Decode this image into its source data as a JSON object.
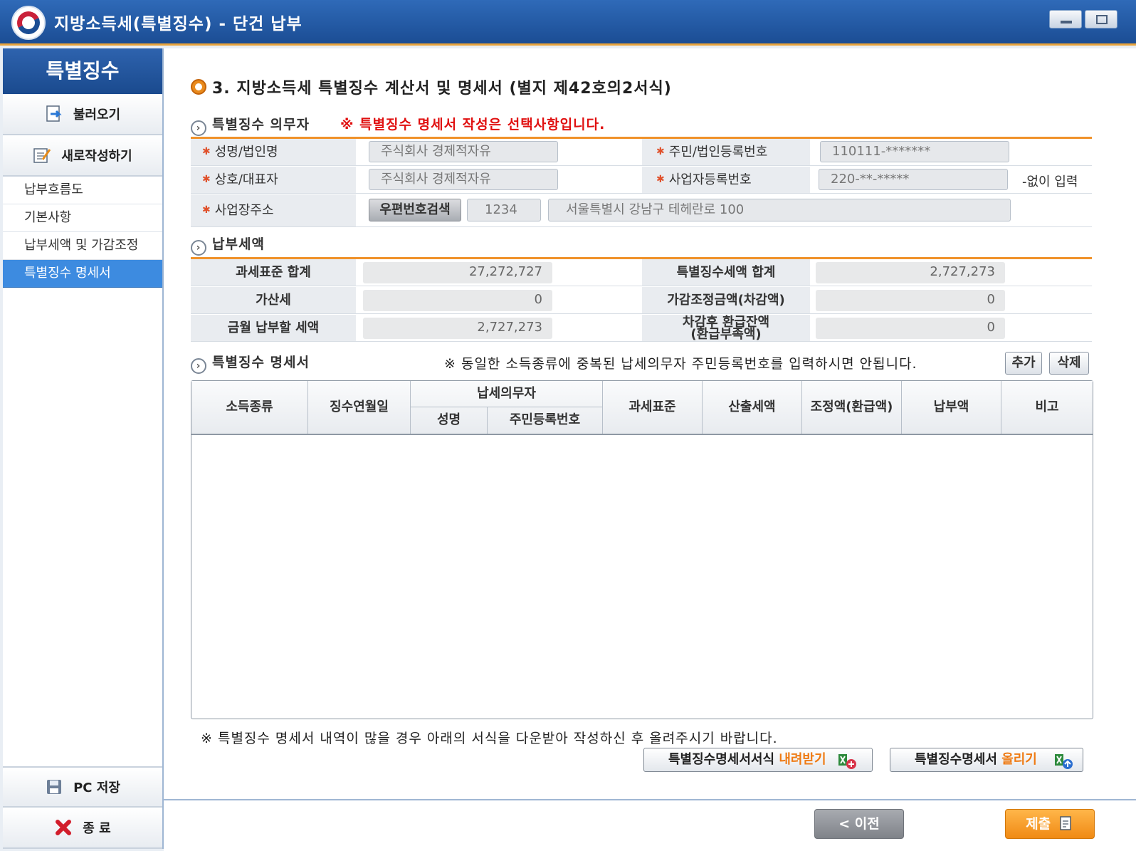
{
  "window": {
    "title": "지방소득세(특별징수) - 단건 납부"
  },
  "sidebar": {
    "header": "특별징수",
    "load_button": "불러오기",
    "new_button": "새로작성하기",
    "nav": [
      "납부흐름도",
      "기본사항",
      "납부세액 및 가감조정",
      "특별징수 명세서"
    ],
    "active_index": 3,
    "pc_save": "PC 저장",
    "exit": "종 료"
  },
  "main": {
    "section_title": "3. 지방소득세 특별징수 계산서 및 명세서 (별지 제42호의2서식)",
    "obligor": {
      "title": "특별징수 의무자",
      "notice": "※ 특별징수 명세서 작성은 선택사항입니다.",
      "name_label": "성명/법인명",
      "name_value": "주식회사 경제적자유",
      "resident_label": "주민/법인등록번호",
      "resident_value": "110111-*******",
      "company_label": "상호/대표자",
      "company_value": "주식회사 경제적자유",
      "bizno_label": "사업자등록번호",
      "bizno_value": "220-**-*****",
      "bizno_hint": "-없이 입력",
      "address_label": "사업장주소",
      "zip_button": "우편번호검색",
      "zip_value": "1234",
      "address_value": "서울특별시 강남구 테헤란로 100"
    },
    "tax": {
      "title": "납부세액",
      "std_total_label": "과세표준 합계",
      "std_total_value": "27,272,727",
      "special_total_label": "특별징수세액 합계",
      "special_total_value": "2,727,273",
      "penalty_label": "가산세",
      "penalty_value": "0",
      "adjust_label": "가감조정금액(차감액)",
      "adjust_value": "0",
      "month_label": "금월 납부할 세액",
      "month_value": "2,727,273",
      "refund_label_1": "차감후 환급잔액",
      "refund_label_2": "(환급부족액)",
      "refund_value": "0"
    },
    "statement": {
      "title": "특별징수 명세서",
      "notice": "※ 동일한 소득종류에 중복된 납세의무자 주민등록번호를 입력하시면 안됩니다.",
      "add_button": "추가",
      "delete_button": "삭제",
      "columns": {
        "income_type": "소득종류",
        "collect_date": "징수연월일",
        "taxpayer": "납세의무자",
        "name": "성명",
        "resident_no": "주민등록번호",
        "tax_base": "과세표준",
        "calc_tax": "산출세액",
        "adjust": "조정액(환급액)",
        "paid": "납부액",
        "remark": "비고"
      },
      "bottom_notice": "※ 특별징수 명세서 내역이 많을 경우 아래의 서식을 다운받아 작성하신 후 올려주시기 바랍니다.",
      "download_prefix": "특별징수명세서서식 ",
      "download_hl": "내려받기",
      "upload_prefix": "특별징수명세서 ",
      "upload_hl": "올리기"
    }
  },
  "footer": {
    "prev_button": "< 이전",
    "submit_button": "제출"
  }
}
